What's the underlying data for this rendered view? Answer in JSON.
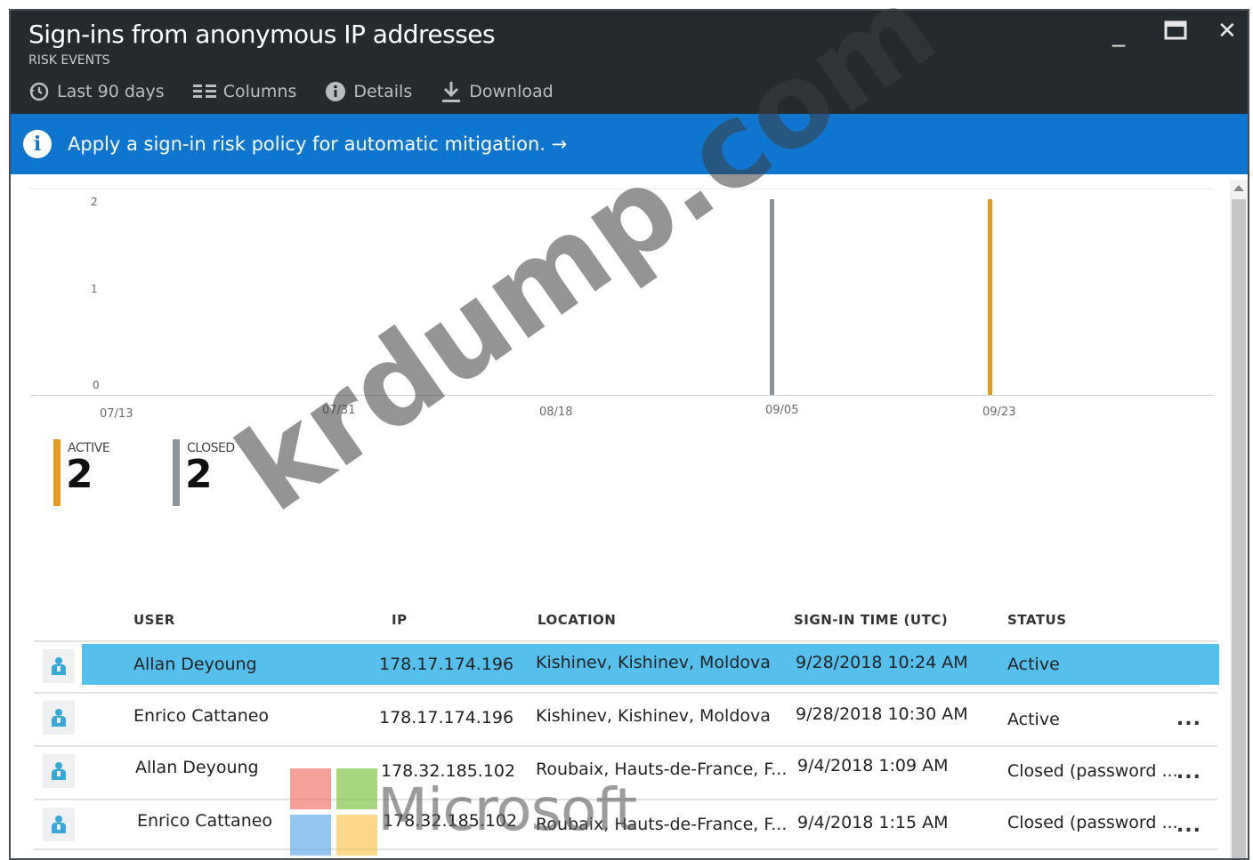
{
  "window": {
    "title": "Sign-ins from anonymous IP addresses",
    "subtitle": "RISK EVENTS",
    "minimize_glyph": "_",
    "maximize_glyph": "□",
    "close_glyph": "✕"
  },
  "toolbar": {
    "range_label": "Last 90 days",
    "columns_label": "Columns",
    "details_label": "Details",
    "download_label": "Download"
  },
  "banner": {
    "message": "Apply a sign-in risk policy for automatic mitigation. →"
  },
  "chart_data": {
    "type": "bar",
    "y_ticks": [
      "2",
      "1",
      "0"
    ],
    "x_ticks": [
      "07/13",
      "07/31",
      "08/18",
      "09/05",
      "09/23"
    ],
    "ylim": [
      0,
      2
    ],
    "series": [
      {
        "name": "CLOSED",
        "x": "09/04",
        "value": 2,
        "color": "#8c9499"
      },
      {
        "name": "ACTIVE",
        "x": "09/28",
        "value": 2,
        "color": "#e39b1f"
      }
    ]
  },
  "legend": {
    "active": {
      "label": "ACTIVE",
      "count": "2",
      "color": "#e39b1f"
    },
    "closed": {
      "label": "CLOSED",
      "count": "2",
      "color": "#8c9499"
    }
  },
  "table": {
    "columns": [
      "USER",
      "IP",
      "LOCATION",
      "SIGN-IN TIME (UTC)",
      "STATUS"
    ],
    "rows": [
      {
        "user": "Allan Deyoung",
        "ip": "178.17.174.196",
        "location": "Kishinev, Kishinev, Moldova",
        "time": "9/28/2018 10:24 AM",
        "status": "Active",
        "more": ""
      },
      {
        "user": "Enrico Cattaneo",
        "ip": "178.17.174.196",
        "location": "Kishinev, Kishinev, Moldova",
        "time": "9/28/2018 10:30 AM",
        "status": "Active",
        "more": "..."
      },
      {
        "user": "Allan Deyoung",
        "ip": "178.32.185.102",
        "location": "Roubaix, Hauts-de-France, F...",
        "time": "9/4/2018 1:09 AM",
        "status": "Closed (password ...",
        "more": "..."
      },
      {
        "user": "Enrico Cattaneo",
        "ip": "178.32.185.102",
        "location": "Roubaix, Hauts-de-France, F...",
        "time": "9/4/2018 1:15 AM",
        "status": "Closed (password ...",
        "more": "..."
      }
    ]
  },
  "overlay": {
    "watermark": "krdump.com",
    "logo_text": "Microsoft"
  }
}
